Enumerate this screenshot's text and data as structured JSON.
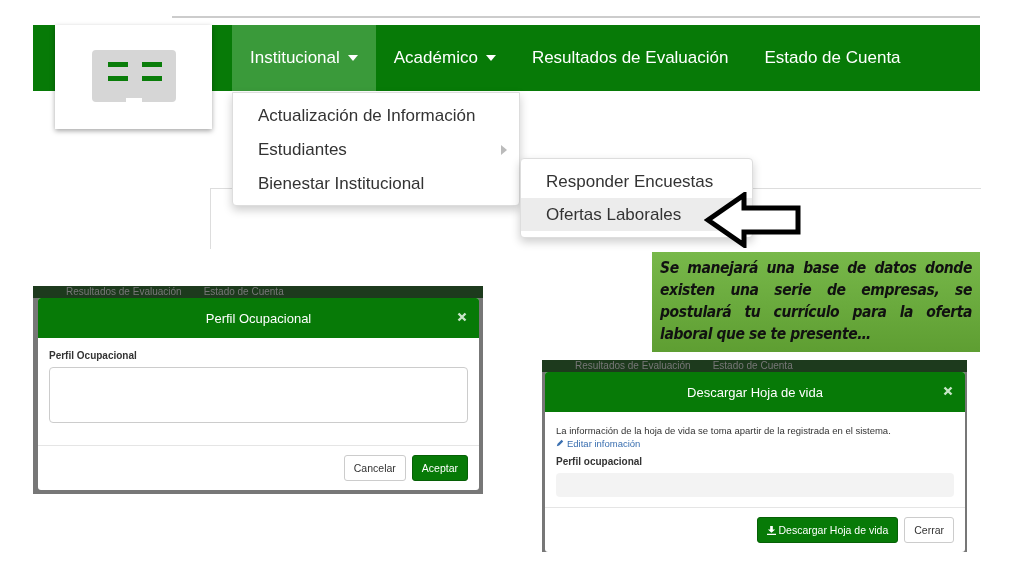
{
  "navbar": {
    "items": [
      {
        "label": "Institucional",
        "caret": true,
        "selected": true
      },
      {
        "label": "Académico",
        "caret": true,
        "selected": false
      },
      {
        "label": "Resultados de Evaluación",
        "caret": false,
        "selected": false
      },
      {
        "label": "Estado de Cuenta",
        "caret": false,
        "selected": false
      }
    ]
  },
  "dropdown": {
    "items": [
      {
        "label": "Actualización de Información",
        "submenu": false
      },
      {
        "label": "Estudiantes",
        "submenu": true
      },
      {
        "label": "Bienestar Institucional",
        "submenu": false
      }
    ]
  },
  "submenu": {
    "items": [
      {
        "label": "Responder Encuestas",
        "selected": false
      },
      {
        "label": "Ofertas Laborales",
        "selected": true
      }
    ]
  },
  "callout": {
    "text": "Se manejará una base de datos donde existen una serie de empresas, se postulará tu currículo para la oferta laboral que se te presente…"
  },
  "modals": [
    {
      "kind": "edit",
      "backdrop_items": [
        "Resultados de Evaluación",
        "Estado de Cuenta"
      ],
      "title": "Perfil Ocupacional",
      "field_label": "Perfil Ocupacional",
      "buttons": [
        {
          "label": "Cancelar",
          "kind": "default"
        },
        {
          "label": "Aceptar",
          "kind": "primary"
        }
      ]
    },
    {
      "kind": "download",
      "backdrop_items": [
        "Resultados de Evaluación",
        "Estado de Cuenta"
      ],
      "title": "Descargar Hoja de vida",
      "message": "La información de la hoja de vida se toma apartir de la registrada en el sistema.",
      "link": "Editar infomación",
      "field_label": "Perfil ocupacional",
      "buttons": [
        {
          "label": "Descargar Hoja de vida",
          "kind": "primary"
        },
        {
          "label": "Cerrar",
          "kind": "default"
        }
      ]
    }
  ]
}
